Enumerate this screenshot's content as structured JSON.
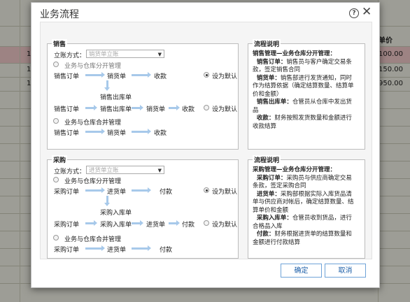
{
  "background": {
    "header_fragment": "单价",
    "row_numbers": [
      "1",
      "1",
      "1"
    ],
    "amounts": [
      "100.00",
      "150.00",
      "950.00"
    ]
  },
  "dialog": {
    "title": "业务流程",
    "ok_label": "确定",
    "cancel_label": "取消"
  },
  "sales": {
    "title": "销售",
    "account_label": "立账方式：",
    "account_placeholder": "销货单立账",
    "separate_label": "业务与仓库分开管理",
    "combined_label": "业务与仓库合并管理",
    "default_label": "设为默认",
    "f1": [
      "销售订单",
      "销货单",
      "收款"
    ],
    "outbound": "销售出库单",
    "f2": [
      "销售订单",
      "销售出库单",
      "销货单",
      "收款"
    ],
    "f3": [
      "销售订单",
      "销货单",
      "收款"
    ]
  },
  "purchase": {
    "title": "采购",
    "account_label": "立账方式：",
    "account_placeholder": "进货单立账",
    "separate_label": "业务与仓库分开管理",
    "combined_label": "业务与仓库合并管理",
    "default_label": "设为默认",
    "f1": [
      "采购订单",
      "进货单",
      "付款"
    ],
    "inbound": "采购入库单",
    "f2": [
      "采购订单",
      "采购入库单",
      "进货单",
      "付款"
    ],
    "f3": [
      "采购订单",
      "进货单",
      "付款"
    ]
  },
  "sales_desc": {
    "title": "流程说明",
    "lines": [
      {
        "bold": "销售管理—业务仓库分开管理：",
        "text": ""
      },
      {
        "bold": "  销售订单：",
        "text": "销售员与客户确定交易条"
      },
      {
        "bold": "",
        "text": "款，签定销售合同"
      },
      {
        "bold": "  销货单：",
        "text": "销售部进行发货通知，同时"
      },
      {
        "bold": "",
        "text": "作为结算依据（确定结算数量、结算单"
      },
      {
        "bold": "",
        "text": "价和金额）"
      },
      {
        "bold": "  销售出库单：",
        "text": "仓管员从仓库中发出货"
      },
      {
        "bold": "",
        "text": "品"
      },
      {
        "bold": "  收款：",
        "text": "财务按照发货数量和金额进行"
      },
      {
        "bold": "",
        "text": "收款结算"
      }
    ]
  },
  "purchase_desc": {
    "title": "流程说明",
    "lines": [
      {
        "bold": "采购管理—业务仓库分开管理：",
        "text": ""
      },
      {
        "bold": "  采购订单：",
        "text": "采购员与供应商确定交易"
      },
      {
        "bold": "",
        "text": "条款，签定采购合同"
      },
      {
        "bold": "  进货单：",
        "text": "采购部根据实际入库货品清"
      },
      {
        "bold": "",
        "text": "单与供应商对帐后，确定结算数量、结"
      },
      {
        "bold": "",
        "text": "算单价和金额"
      },
      {
        "bold": "  采购入库单：",
        "text": "仓管员收到货品，进行"
      },
      {
        "bold": "",
        "text": "合格品入库"
      },
      {
        "bold": "  付款：",
        "text": "财务根据进货单的结算数量和"
      },
      {
        "bold": "",
        "text": "金额进行付款结算"
      }
    ]
  }
}
